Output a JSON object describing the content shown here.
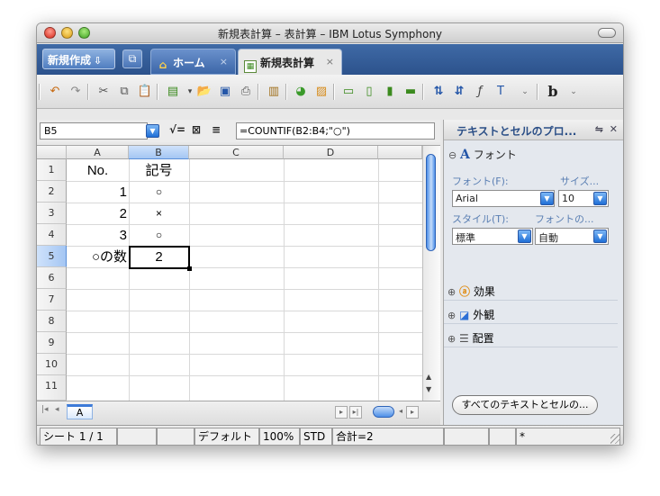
{
  "window": {
    "title": "新規表計算 – 表計算 – IBM Lotus Symphony"
  },
  "tabbar": {
    "new_label": "新規作成",
    "home_tab": "ホーム",
    "doc_tab": "新規表計算",
    "close_glyph": "×"
  },
  "formula": {
    "cell_ref": "B5",
    "content": "=COUNTIF(B2:B4;\"○\")",
    "fx1": "√=",
    "fx2": "≡"
  },
  "sheet": {
    "columns": [
      "A",
      "B",
      "C",
      "D"
    ],
    "rows": [
      "1",
      "2",
      "3",
      "4",
      "5",
      "6",
      "7",
      "8",
      "9",
      "10",
      "11"
    ],
    "cells": {
      "A1": "No.",
      "B1": "記号",
      "A2": "1",
      "B2": "○",
      "A3": "2",
      "B3": "×",
      "A4": "3",
      "B4": "○",
      "A5": "○の数",
      "B5": "2"
    },
    "active_cell": "B5",
    "tab_name": "A"
  },
  "sidebar": {
    "title": "テキストとセルのプロ...",
    "font_section": "フォント",
    "font_label": "フォント(F):",
    "size_label": "サイズ...",
    "font_value": "Arial",
    "size_value": "10",
    "style_label": "スタイル(T):",
    "fontcolor_label": "フォントの...",
    "style_value": "標準",
    "color_value": "自動",
    "effects": "効果",
    "appearance": "外観",
    "alignment": "配置",
    "all_button": "すべてのテキストとセルの..."
  },
  "status": {
    "sheet": "シート 1 / 1",
    "style": "デフォルト",
    "zoom": "100%",
    "mode": "STD",
    "sum": "合計=2",
    "star": "*"
  },
  "accent": "#2c528c",
  "selection_color": "#a4c6f3"
}
